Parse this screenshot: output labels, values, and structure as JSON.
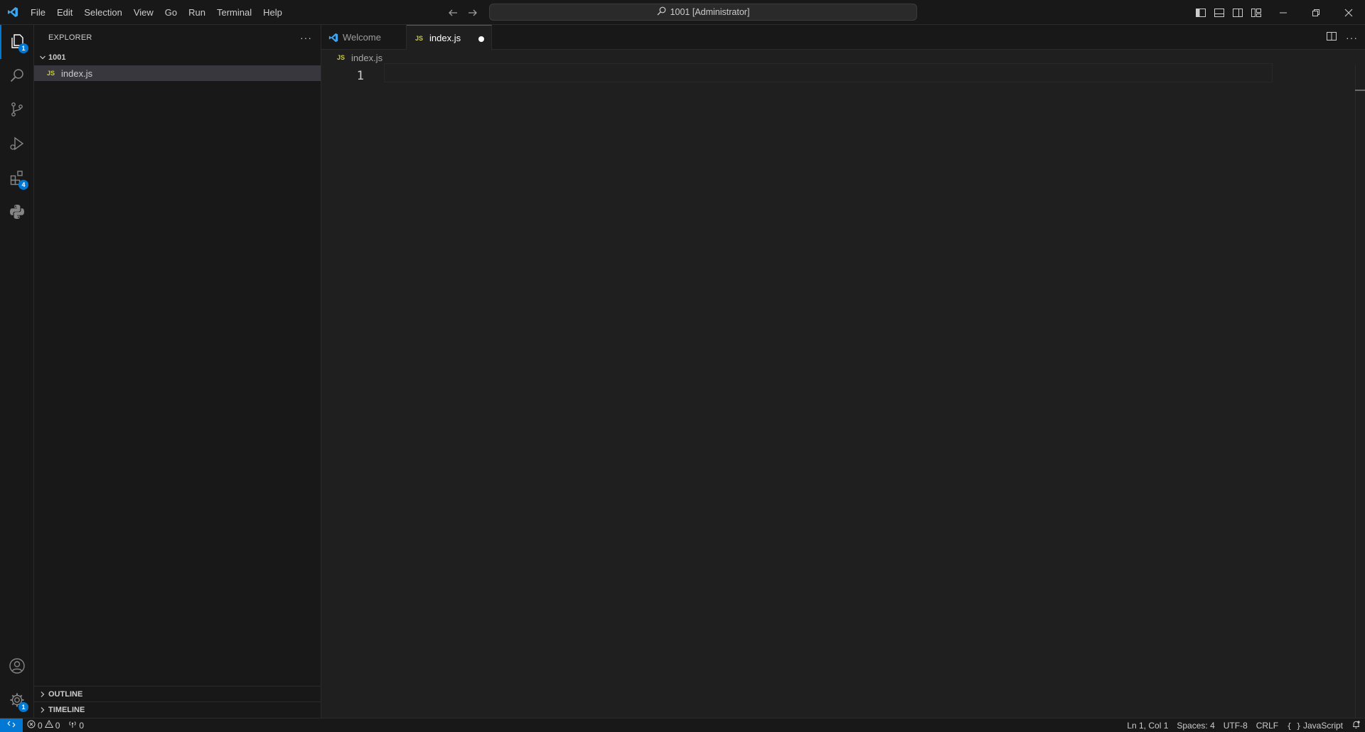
{
  "titlebar": {
    "menu": [
      "File",
      "Edit",
      "Selection",
      "View",
      "Go",
      "Run",
      "Terminal",
      "Help"
    ],
    "search_text": "1001 [Administrator]"
  },
  "activitybar": {
    "explorer_badge": "1",
    "extensions_badge": "4",
    "settings_badge": "1"
  },
  "sidebar": {
    "title": "EXPLORER",
    "folder": "1001",
    "files": [
      {
        "name": "index.js",
        "type": "JS"
      }
    ],
    "outline": "OUTLINE",
    "timeline": "TIMELINE"
  },
  "editor": {
    "tabs": [
      {
        "label": "Welcome",
        "active": false
      },
      {
        "label": "index.js",
        "type": "JS",
        "active": true,
        "dirty": true
      }
    ],
    "breadcrumb_type": "JS",
    "breadcrumb": "index.js",
    "line_number": "1"
  },
  "statusbar": {
    "errors": "0",
    "warnings": "0",
    "ports": "0",
    "position": "Ln 1, Col 1",
    "spaces": "Spaces: 4",
    "encoding": "UTF-8",
    "eol": "CRLF",
    "language": "JavaScript"
  },
  "colors": {
    "accent": "#0078d4",
    "background": "#1f1f1f",
    "sidebar": "#181818",
    "js_icon": "#cbcb41"
  }
}
